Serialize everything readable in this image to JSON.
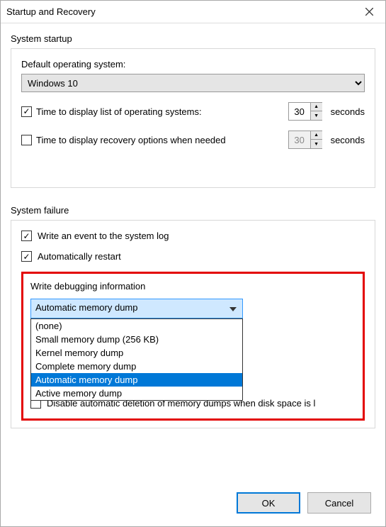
{
  "window": {
    "title": "Startup and Recovery"
  },
  "startup": {
    "group_label": "System startup",
    "default_os_label": "Default operating system:",
    "default_os_value": "Windows 10",
    "time_list_label": "Time to display list of operating systems:",
    "time_list_value": "30",
    "time_list_checked": true,
    "time_recovery_label": "Time to display recovery options when needed",
    "time_recovery_value": "30",
    "time_recovery_checked": false,
    "seconds_label": "seconds"
  },
  "failure": {
    "group_label": "System failure",
    "write_event_label": "Write an event to the system log",
    "auto_restart_label": "Automatically restart",
    "debug_label": "Write debugging information",
    "dump_selected": "Automatic memory dump",
    "dump_options": {
      "none": "(none)",
      "small": "Small memory dump (256 KB)",
      "kernel": "Kernel memory dump",
      "complete": "Complete memory dump",
      "automatic": "Automatic memory dump",
      "active": "Active memory dump"
    },
    "disable_delete_label": "Disable automatic deletion of memory dumps when disk space is l"
  },
  "buttons": {
    "ok": "OK",
    "cancel": "Cancel"
  }
}
